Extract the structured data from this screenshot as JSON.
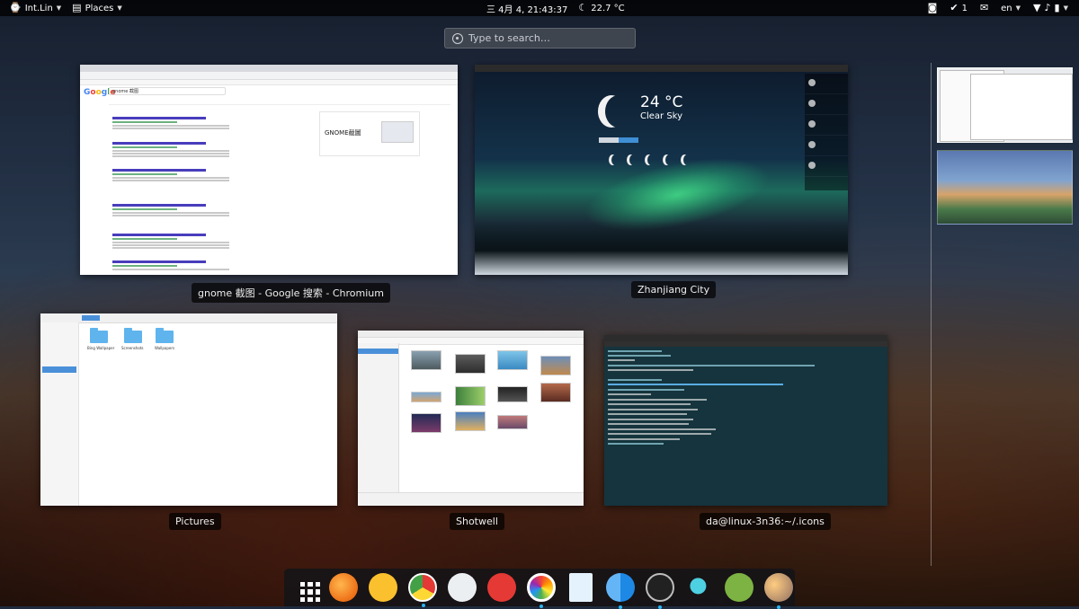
{
  "topbar": {
    "user_label": "Int.Lin",
    "places_label": "Places",
    "datetime": "三 4月  4, 21:43:37",
    "weather_temp": "22.7 °C",
    "notifications_count": "1",
    "language": "en",
    "icons": [
      "user-icon",
      "places-icon",
      "weather-moon-icon",
      "screenshot-icon",
      "checkmark-icon",
      "mail-icon",
      "chevron-down-icon",
      "wifi-icon",
      "volume-icon",
      "battery-icon",
      "power-icon"
    ]
  },
  "search": {
    "placeholder": "Type to search…"
  },
  "windows": [
    {
      "id": "chromium",
      "caption": "gnome 截图 - Google 搜索 - Chromium",
      "search_query": "gnome 截图",
      "knowledge_title": "GNOME截圖"
    },
    {
      "id": "weather",
      "caption": "Zhanjiang City",
      "temperature": "24 °C",
      "condition": "Clear Sky"
    },
    {
      "id": "files",
      "caption": "Pictures",
      "folders": [
        "Bing Wallpaper",
        "Screenshots",
        "Wallpapers"
      ]
    },
    {
      "id": "shotwell",
      "caption": "Shotwell"
    },
    {
      "id": "terminal",
      "caption": "da@linux-3n36:~/.icons"
    }
  ],
  "dock": {
    "items": [
      {
        "name": "show-applications-icon"
      },
      {
        "name": "firefox-icon"
      },
      {
        "name": "notes-icon"
      },
      {
        "name": "chrome-icon"
      },
      {
        "name": "mail-clock-icon"
      },
      {
        "name": "chat-bubble-icon"
      },
      {
        "name": "photos-icon"
      },
      {
        "name": "document-icon"
      },
      {
        "name": "finder-icon"
      },
      {
        "name": "terminal-icon"
      },
      {
        "name": "search-icon"
      },
      {
        "name": "media-player-icon"
      },
      {
        "name": "weather-icon"
      }
    ],
    "accent": "#29b6f6"
  }
}
